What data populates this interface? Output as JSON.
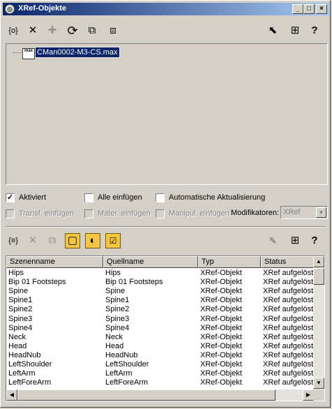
{
  "window": {
    "title": "XRef-Objekte",
    "app_icon": "3ds-max-icon",
    "controls": {
      "minimize": "_",
      "maximize": "□",
      "close": "×"
    }
  },
  "toolbar1": {
    "icons": {
      "a": "{o}",
      "b": "✕",
      "c": "✚",
      "d": "⟳",
      "e": "⧉",
      "f": "⧈",
      "g": "⬉",
      "h": "⊞",
      "i": "?"
    }
  },
  "tree": {
    "file_icon_text": "max",
    "selected_file": "CMan0002-M3-CS.max"
  },
  "options": {
    "aktiviert": {
      "label": "Aktiviert",
      "checked": "✓"
    },
    "alle_einfuegen": {
      "label": "Alle einfügen",
      "checked": ""
    },
    "auto_aktualisierung": {
      "label": "Automatische Aktualisierung",
      "checked": ""
    },
    "transf_einfuegen": {
      "label": "Transf. einfügen",
      "checked": ""
    },
    "mater_einfuegen": {
      "label": "Mater. einfügen",
      "checked": ""
    },
    "manipul_einfuegen": {
      "label": "Manipul. einfügen",
      "checked": ""
    },
    "modifikatoren_label": "Modifikatoren:",
    "modifikatoren_value": "XRef"
  },
  "toolbar2": {
    "icons": {
      "a": "{≡}",
      "b": "✕",
      "c": "⧉",
      "d": "▢",
      "e": "◐",
      "f": "☑",
      "g": "⬉",
      "h": "⊞",
      "i": "?"
    }
  },
  "table": {
    "columns": [
      "Szenenname",
      "Quellname",
      "Typ",
      "Status"
    ],
    "rows": [
      [
        "Hips",
        "Hips",
        "XRef-Objekt",
        "XRef aufgelöst"
      ],
      [
        "Bip 01 Footsteps",
        "Bip 01 Footsteps",
        "XRef-Objekt",
        "XRef aufgelöst"
      ],
      [
        "Spine",
        "Spine",
        "XRef-Objekt",
        "XRef aufgelöst"
      ],
      [
        "Spine1",
        "Spine1",
        "XRef-Objekt",
        "XRef aufgelöst"
      ],
      [
        "Spine2",
        "Spine2",
        "XRef-Objekt",
        "XRef aufgelöst"
      ],
      [
        "Spine3",
        "Spine3",
        "XRef-Objekt",
        "XRef aufgelöst"
      ],
      [
        "Spine4",
        "Spine4",
        "XRef-Objekt",
        "XRef aufgelöst"
      ],
      [
        "Neck",
        "Neck",
        "XRef-Objekt",
        "XRef aufgelöst"
      ],
      [
        "Head",
        "Head",
        "XRef-Objekt",
        "XRef aufgelöst"
      ],
      [
        "HeadNub",
        "HeadNub",
        "XRef-Objekt",
        "XRef aufgelöst"
      ],
      [
        "LeftShoulder",
        "LeftShoulder",
        "XRef-Objekt",
        "XRef aufgelöst"
      ],
      [
        "LeftArm",
        "LeftArm",
        "XRef-Objekt",
        "XRef aufgelöst"
      ],
      [
        "LeftForeArm",
        "LeftForeArm",
        "XRef-Objekt",
        "XRef aufgelöst"
      ]
    ],
    "scroll_up": "▲",
    "scroll_down": "▼",
    "scroll_left": "◀",
    "scroll_right": "▶"
  }
}
